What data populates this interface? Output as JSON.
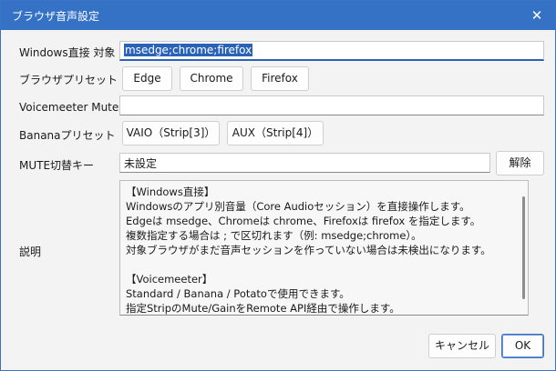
{
  "window": {
    "title": "ブラウザ音声設定"
  },
  "fields": {
    "windows_direct_label": "Windows直接 対象",
    "windows_direct_value": "msedge;chrome;firefox",
    "browser_preset_label": "ブラウザプリセット",
    "voicemeeter_mute_label": "Voicemeeter Mute",
    "voicemeeter_mute_value": "",
    "banana_preset_label": "Bananaプリセット",
    "mute_hotkey_label": "MUTE切替キー",
    "mute_hotkey_value": "未設定",
    "description_label": "説明"
  },
  "buttons": {
    "edge": "Edge",
    "chrome": "Chrome",
    "firefox": "Firefox",
    "vaio": "VAIO（Strip[3]）",
    "aux": "AUX（Strip[4]）",
    "clear": "解除",
    "cancel": "キャンセル",
    "ok": "OK"
  },
  "description_lines": [
    "【Windows直接】",
    "Windowsのアプリ別音量（Core Audioセッション）を直接操作します。",
    "Edgeは msedge、Chromeは chrome、Firefoxは firefox を指定します。",
    "複数指定する場合は ; で区切れます（例: msedge;chrome）。",
    "対象ブラウザがまだ音声セッションを作っていない場合は未検出になります。",
    "",
    "【Voicemeeter】",
    "Standard / Banana / Potatoで使用できます。",
    "指定StripのMute/GainをRemote API経由で操作します。"
  ],
  "icons": {
    "close": "close-icon"
  }
}
